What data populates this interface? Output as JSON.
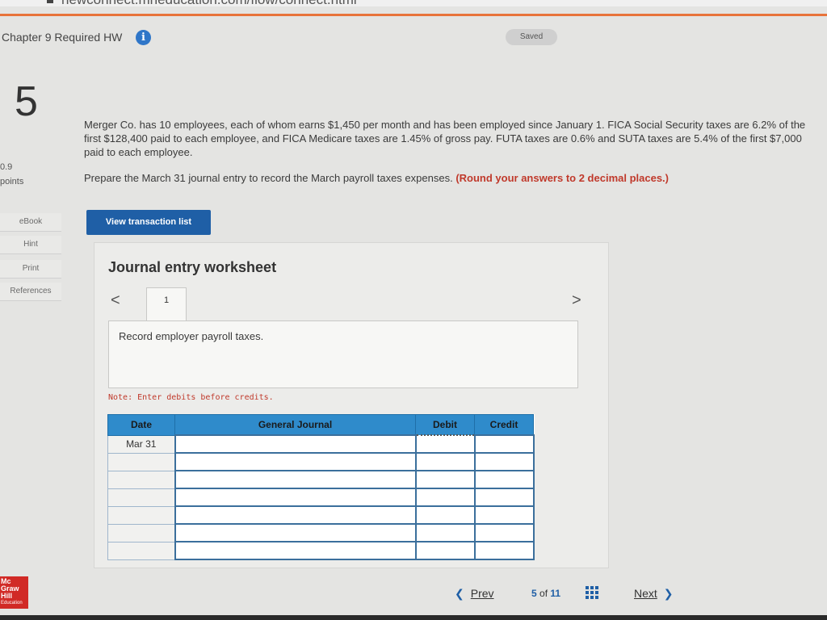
{
  "browser": {
    "url": "newconnect.mheducation.com/flow/connect.html"
  },
  "header": {
    "title": "Chapter 9 Required HW",
    "info_icon": "i",
    "saved_label": "Saved"
  },
  "question": {
    "number": "5",
    "points_value": "0.9",
    "points_label": "points"
  },
  "sidebar": {
    "items": [
      {
        "label": "eBook"
      },
      {
        "label": "Hint"
      },
      {
        "label": "Print"
      },
      {
        "label": "References"
      }
    ]
  },
  "problem": {
    "text": "Merger Co. has 10 employees, each of whom earns $1,450 per month and has been employed since January 1. FICA Social Security taxes are 6.2% of the first $128,400 paid to each employee, and FICA Medicare taxes are 1.45% of gross pay. FUTA taxes are 0.6% and SUTA taxes are 5.4% of the first $7,000 paid to each employee.",
    "instruction": "Prepare the March 31 journal entry to record the March payroll taxes expenses.",
    "round_note": "(Round your answers to 2 decimal places.)"
  },
  "buttons": {
    "view_transaction_list": "View transaction list"
  },
  "worksheet": {
    "title": "Journal entry worksheet",
    "prev_arrow": "<",
    "next_arrow": ">",
    "tab_label": "1",
    "record_text": "Record employer payroll taxes.",
    "note": "Note: Enter debits before credits.",
    "columns": [
      "Date",
      "General Journal",
      "Debit",
      "Credit"
    ],
    "rows": [
      {
        "date": "Mar 31"
      },
      {
        "date": ""
      },
      {
        "date": ""
      },
      {
        "date": ""
      },
      {
        "date": ""
      },
      {
        "date": ""
      },
      {
        "date": ""
      }
    ]
  },
  "footer": {
    "logo_line1": "Mc",
    "logo_line2": "Graw",
    "logo_line3": "Hill",
    "logo_line4": "Education",
    "prev_label": "Prev",
    "page_current": "5",
    "page_of": "of",
    "page_total": "11",
    "next_label": "Next"
  }
}
